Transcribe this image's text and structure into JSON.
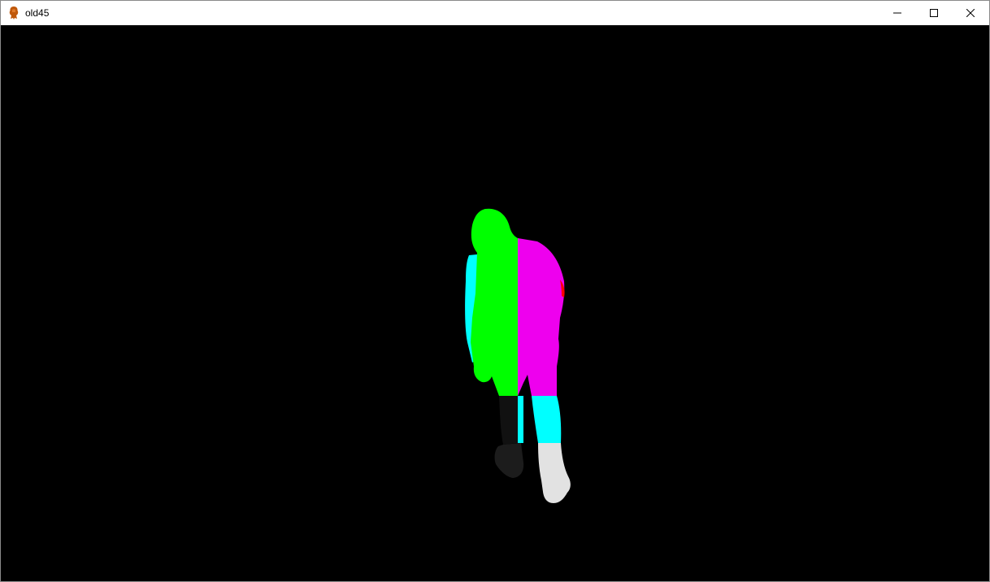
{
  "window": {
    "title": "old45",
    "app_icon": "app-icon",
    "controls": {
      "minimize_icon": "minimize-icon",
      "maximize_icon": "maximize-icon",
      "close_icon": "close-icon"
    }
  },
  "canvas": {
    "background": "#000000",
    "segment_colors": {
      "head_torso_left": "#00ff00",
      "torso_right": "#ee00ee",
      "arm_left": "#00ffff",
      "arm_right_edge": "#ff0000",
      "thigh_left": "#111111",
      "thigh_right": "#00ffff",
      "shin_left": "#1a1a1a",
      "shin_right": "#e6e6e6"
    }
  }
}
